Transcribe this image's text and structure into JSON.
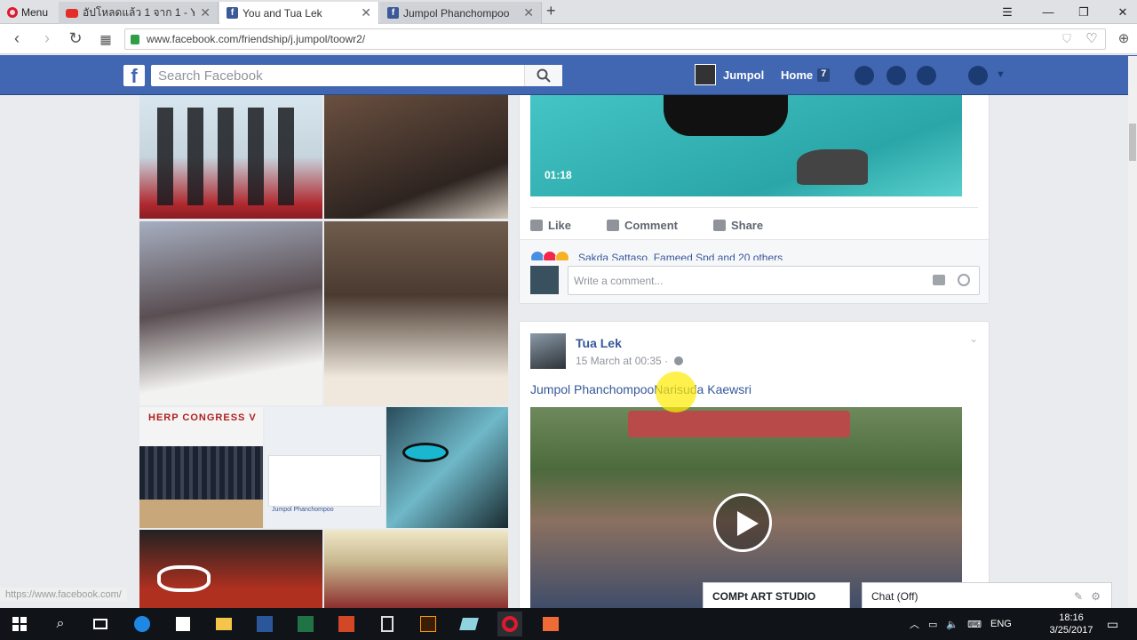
{
  "browser": {
    "menu_label": "Menu",
    "tabs": [
      {
        "title": "อัปโหลดแล้ว 1 จาก 1 - YouTu",
        "icon": "youtube-icon"
      },
      {
        "title": "You and Tua Lek",
        "icon": "facebook-icon"
      },
      {
        "title": "Jumpol Phanchompoo",
        "icon": "facebook-icon"
      }
    ],
    "url": "www.facebook.com/friendship/j.jumpol/toowr2/"
  },
  "fb_header": {
    "logo": "f",
    "search_placeholder": "Search Facebook",
    "user_name": "Jumpol",
    "home_label": "Home",
    "home_count": "7"
  },
  "video_post": {
    "duration": "01:18",
    "like_label": "Like",
    "comment_label": "Comment",
    "share_label": "Share",
    "reactions_text": "Sakda Sattaso, Fameed Spd and 20 others",
    "comment_placeholder": "Write a comment..."
  },
  "second_post": {
    "author": "Tua Lek",
    "time": "15 March at 00:35 ·",
    "tags": "Jumpol PhanchompooNarisuda Kaewsri"
  },
  "left_photos": {
    "herp_label": "HERP CONGRESS V",
    "mini_profile": "Jumpol Phanchompoo"
  },
  "chat": {
    "studio_label": "COMPt ART STUDIO",
    "chat_label": "Chat (Off)"
  },
  "status_url": "https://www.facebook.com/",
  "taskbar": {
    "lang": "ENG",
    "time": "18:16",
    "date": "3/25/2017"
  }
}
